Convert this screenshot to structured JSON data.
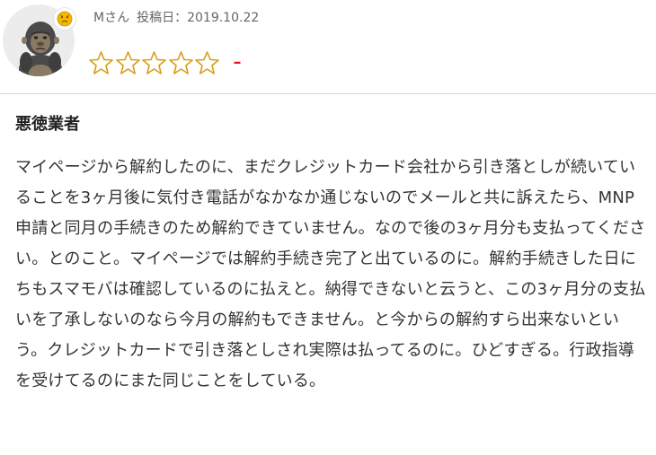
{
  "review": {
    "reviewer": "Mさん",
    "post_label": "投稿日：",
    "post_date": "2019.10.22",
    "mood_icon": "frown-face-icon",
    "avatar_icon": "gorilla-avatar-icon",
    "rating": 0,
    "rating_max": 5,
    "score_text": "–",
    "title": "悪徳業者",
    "body": "マイページから解約したのに、まだクレジットカード会社から引き落としが続いていることを3ヶ月後に気付き電話がなかなか通じないのでメールと共に訴えたら、MNP申請と同月の手続きのため解約できていません。なので後の3ヶ月分も支払ってください。とのこと。マイページでは解約手続き完了と出ているのに。解約手続きした日にちもスマモバは確認しているのに払えと。納得できないと云うと、この3ヶ月分の支払いを了承しないのなら今月の解約もできません。と今からの解約すら出来ないという。クレジットカードで引き落としされ実際は払ってるのに。ひどすぎる。行政指導を受けてるのにまた同じことをしている。"
  },
  "colors": {
    "star_outline": "#d4a017",
    "score": "#e8112d",
    "divider": "#d6d6d6"
  }
}
